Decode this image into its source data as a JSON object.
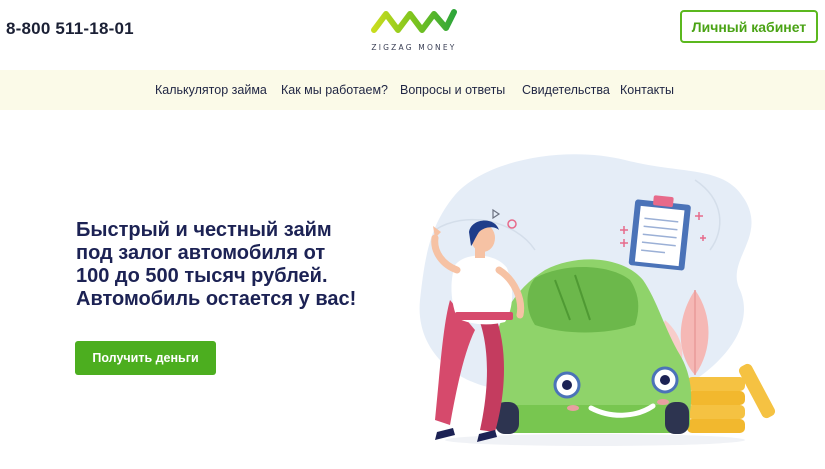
{
  "header": {
    "phone": "8-800 511-18-01",
    "logo_text": "ZIGZAG MONEY",
    "cabinet_button": "Личный кабинет"
  },
  "nav": {
    "items": [
      "Калькулятор займа",
      "Как мы работаем?",
      "Вопросы и ответы",
      "Свидетельства",
      "Контакты"
    ]
  },
  "hero": {
    "headline_lines": [
      "Быстрый и честный займ",
      "под залог автомобиля от",
      "100 до 500 тысяч рублей.",
      "Автомобиль остается у вас!"
    ],
    "cta_button": "Получить деньги"
  },
  "colors": {
    "accent_green": "#4cae1f",
    "nav_background": "#fbfae8",
    "headline": "#1c2254"
  },
  "illustration": {
    "icon": "person-leaning-on-green-car-illustration"
  }
}
